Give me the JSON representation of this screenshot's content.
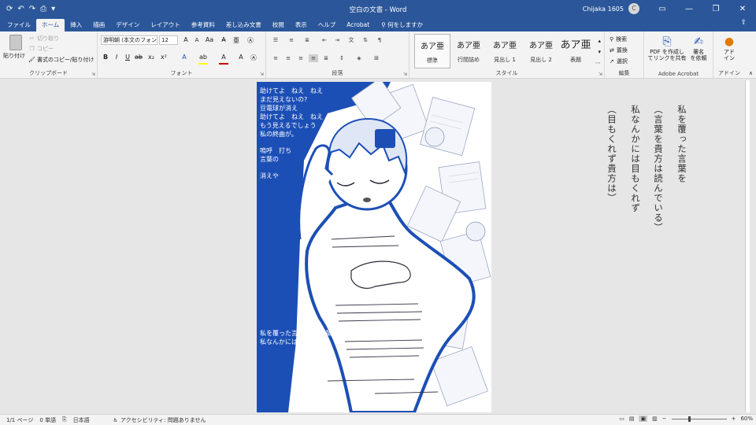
{
  "titlebar": {
    "doc_title": "空白の文書  -  Word",
    "user_name": "Chijaka 1605",
    "avatar_initial": "C",
    "qat_icons": [
      "autosave-icon",
      "undo-icon",
      "redo-icon",
      "print-preview-icon",
      "customize-icon"
    ]
  },
  "tabs": {
    "items": [
      "ファイル",
      "ホーム",
      "挿入",
      "描画",
      "デザイン",
      "レイアウト",
      "参考資料",
      "差し込み文書",
      "校閲",
      "表示",
      "ヘルプ",
      "Acrobat"
    ],
    "active": "ホーム",
    "tell_me": "何をしますか"
  },
  "ribbon": {
    "clipboard": {
      "paste": "貼り付け",
      "cut": "切り取り",
      "copy": "コピー",
      "format_painter": "書式のコピー/貼り付け",
      "label": "クリップボード"
    },
    "font": {
      "font_name": "游明朝 (本文のフォン",
      "font_size": "12",
      "label": "フォント",
      "font_color": "#c00000",
      "highlight_color": "#ffff00"
    },
    "paragraph": {
      "label": "段落"
    },
    "styles": {
      "items": [
        {
          "sample": "あア亜",
          "name": "標準"
        },
        {
          "sample": "あア亜",
          "name": "行間詰め"
        },
        {
          "sample": "あア亜",
          "name": "見出し 1"
        },
        {
          "sample": "あア亜",
          "name": "見出し 2"
        },
        {
          "sample": "あア亜",
          "name": "表題"
        }
      ],
      "label": "スタイル"
    },
    "editing": {
      "find": "検索",
      "replace": "置換",
      "select": "選択",
      "label": "編集"
    },
    "acrobat": {
      "create_pdf": "PDF を作成し\nてリンクを共有",
      "sign": "署名\nを依頼",
      "label": "Adobe Acrobat"
    },
    "addin": {
      "name": "アド\nイン",
      "label": "アドイン"
    }
  },
  "page": {
    "vertical_lines": [
      "私を覆った言葉を",
      "（言葉を貴方は読んでいる）",
      "私なんかには目もくれず",
      "（目もくれず貴方は）"
    ],
    "art_lines": [
      "助けてよ　ねえ　ねえ",
      "まだ見えないの?",
      "豆電球が消え",
      "助けてよ　ねえ　ねえ",
      "もう見えるでしょう",
      "私の終曲が。",
      "嗚呼　打ち",
      "言葉の",
      "消えや",
      "私を覆った言葉を　(言葉を",
      "私なんかには目もくれず　(目"
    ],
    "accent_color": "#1c4fb5"
  },
  "status": {
    "page": "1/1 ページ",
    "words": "0 単語",
    "lang": "日本語",
    "accessibility": "アクセシビリティ: 問題ありません",
    "zoom": "60%",
    "zoom_fraction": 0.6
  }
}
